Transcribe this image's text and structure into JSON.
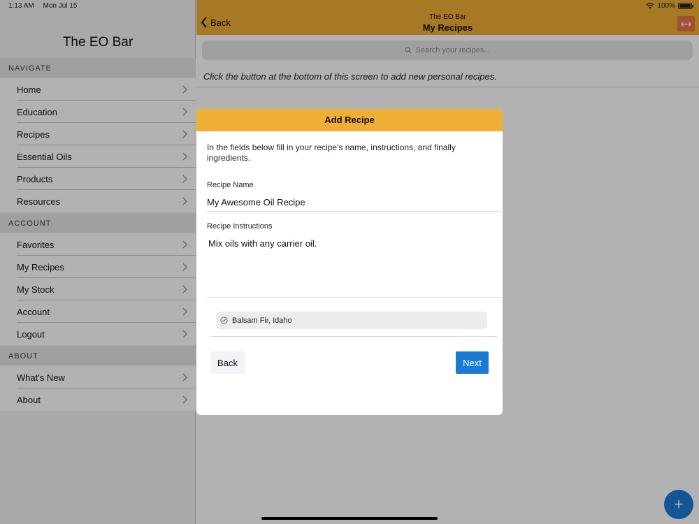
{
  "status_bar": {
    "time": "1:13 AM",
    "date": "Mon Jul 15",
    "battery": "100%",
    "battery_level": 1.0
  },
  "sidebar": {
    "title": "The EO Bar",
    "sections": [
      {
        "header": "NAVIGATE",
        "items": [
          "Home",
          "Education",
          "Recipes",
          "Essential Oils",
          "Products",
          "Resources"
        ]
      },
      {
        "header": "ACCOUNT",
        "items": [
          "Favorites",
          "My Recipes",
          "My Stock",
          "Account",
          "Logout"
        ]
      },
      {
        "header": "ABOUT",
        "items": [
          "What's New",
          "About"
        ]
      }
    ]
  },
  "navbar": {
    "back_label": "Back",
    "subtitle": "The EO Bar",
    "title": "My Recipes",
    "toggle_icon": "expand-icon"
  },
  "search": {
    "placeholder": "Search your recipes..."
  },
  "hint": "Click the button at the bottom of this screen to add new personal recipes.",
  "fab_label": "+",
  "modal": {
    "title": "Add Recipe",
    "intro": "In the fields below fill in your recipe's name, instructions, and finally ingredients.",
    "name_label": "Recipe Name",
    "name_value": "My Awesome Oil Recipe",
    "instructions_label": "Recipe Instructions",
    "instructions_value": "Mix oils with any carrier oil.",
    "ingredient_chip": "Balsam Fir, Idaho",
    "back_label": "Back",
    "next_label": "Next"
  },
  "colors": {
    "accent": "#efae36",
    "primary": "#1a7bd6",
    "toggle": "#e87148"
  }
}
